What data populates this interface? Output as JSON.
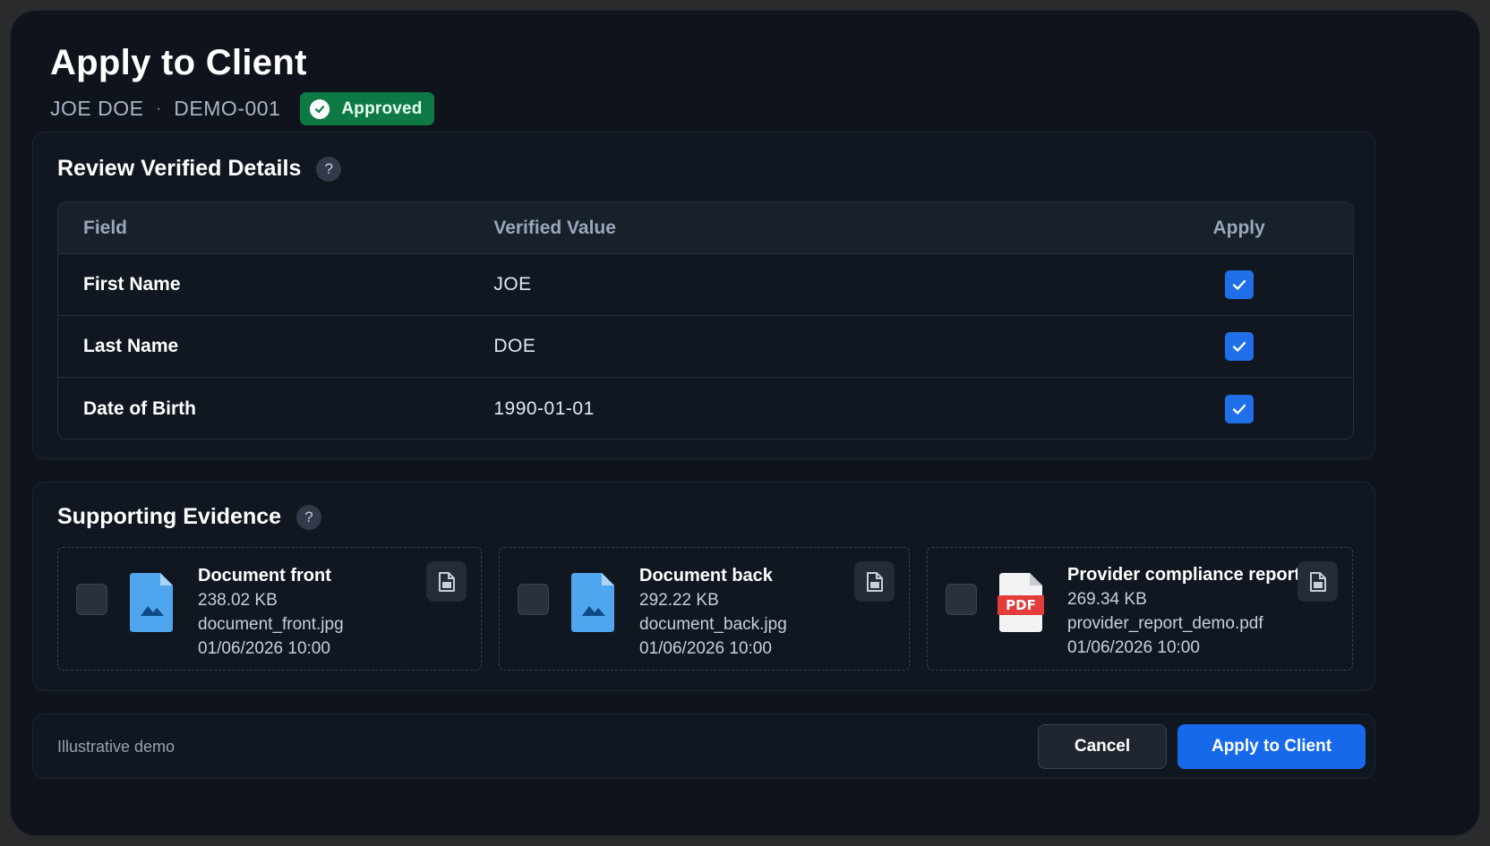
{
  "header": {
    "title": "Apply to Client",
    "client_name": "JOE DOE",
    "separator": "·",
    "client_id": "DEMO-001",
    "status": "Approved",
    "status_color": "#0d7a45"
  },
  "review": {
    "title": "Review Verified Details",
    "help": "?",
    "columns": [
      "Field",
      "Verified Value",
      "Apply"
    ],
    "rows": [
      {
        "field": "First Name",
        "value": "JOE",
        "apply": true
      },
      {
        "field": "Last Name",
        "value": "DOE",
        "apply": true
      },
      {
        "field": "Date of Birth",
        "value": "1990-01-01",
        "apply": true
      }
    ]
  },
  "evidence": {
    "title": "Supporting Evidence",
    "help": "?",
    "items": [
      {
        "name": "Document front",
        "size": "238.02 KB",
        "filename": "document_front.jpg",
        "date": "01/06/2026 10:00",
        "icon": "image-file-icon",
        "selected": false
      },
      {
        "name": "Document back",
        "size": "292.22 KB",
        "filename": "document_back.jpg",
        "date": "01/06/2026 10:00",
        "icon": "image-file-icon",
        "selected": false
      },
      {
        "name": "Provider compliance report",
        "size": "269.34 KB",
        "filename": "provider_report_demo.pdf",
        "date": "01/06/2026 10:00",
        "icon": "pdf-file-icon",
        "icon_label": "PDF",
        "selected": false
      }
    ]
  },
  "footer": {
    "note": "Illustrative demo",
    "cancel_label": "Cancel",
    "apply_label": "Apply to Client",
    "accent": "#1569ea"
  }
}
